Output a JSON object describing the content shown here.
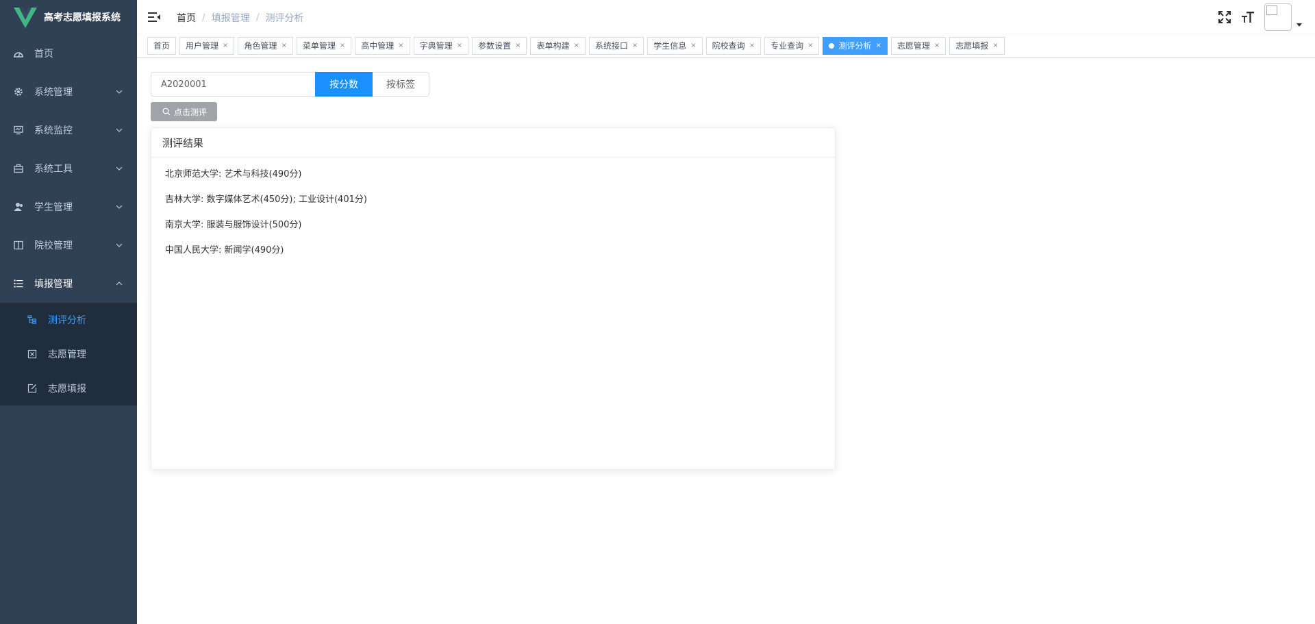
{
  "app": {
    "title": "高考志愿填报系统"
  },
  "sidebar": {
    "items": [
      {
        "label": "首页",
        "icon": "dashboard-icon"
      },
      {
        "label": "系统管理",
        "icon": "gear-icon"
      },
      {
        "label": "系统监控",
        "icon": "monitor-icon"
      },
      {
        "label": "系统工具",
        "icon": "toolbox-icon"
      },
      {
        "label": "学生管理",
        "icon": "user-icon"
      },
      {
        "label": "院校管理",
        "icon": "book-icon"
      },
      {
        "label": "填报管理",
        "icon": "list-icon"
      }
    ],
    "submenu": [
      {
        "label": "测评分析",
        "icon": "tree-icon"
      },
      {
        "label": "志愿管理",
        "icon": "form-icon"
      },
      {
        "label": "志愿填报",
        "icon": "edit-icon"
      }
    ],
    "active_color": "#409eff"
  },
  "breadcrumb": [
    "首页",
    "填报管理",
    "测评分析"
  ],
  "tags": [
    {
      "label": "首页",
      "closable": false
    },
    {
      "label": "用户管理",
      "closable": true
    },
    {
      "label": "角色管理",
      "closable": true
    },
    {
      "label": "菜单管理",
      "closable": true
    },
    {
      "label": "高中管理",
      "closable": true
    },
    {
      "label": "字典管理",
      "closable": true
    },
    {
      "label": "参数设置",
      "closable": true
    },
    {
      "label": "表单构建",
      "closable": true
    },
    {
      "label": "系统接口",
      "closable": true
    },
    {
      "label": "学生信息",
      "closable": true
    },
    {
      "label": "院校查询",
      "closable": true
    },
    {
      "label": "专业查询",
      "closable": true
    },
    {
      "label": "测评分析",
      "closable": true,
      "active": true
    },
    {
      "label": "志愿管理",
      "closable": true
    },
    {
      "label": "志愿填报",
      "closable": true
    }
  ],
  "query": {
    "value": "A2020001",
    "by_score": "按分数",
    "by_tag": "按标签",
    "eval_button": "点击测评"
  },
  "card": {
    "title": "测评结果",
    "lines": [
      "北京师范大学: 艺术与科技(490分)",
      "吉林大学: 数字媒体艺术(450分); 工业设计(401分)",
      "南京大学: 服装与服饰设计(500分)",
      "中国人民大学: 新闻学(490分)"
    ]
  },
  "colors": {
    "sidebar_bg": "#304156",
    "primary": "#1890ff",
    "tag_active": "#409eff"
  }
}
